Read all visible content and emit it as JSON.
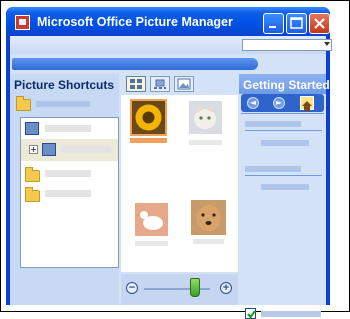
{
  "window": {
    "title": "Microsoft Office Picture Manager",
    "buttons": {
      "minimize": "minimize-icon",
      "maximize": "maximize-icon",
      "close": "close-icon"
    }
  },
  "left_pane": {
    "header": "Picture Shortcuts"
  },
  "right_pane": {
    "header": "Getting Started",
    "nav": [
      "back-icon",
      "forward-icon",
      "home-icon"
    ],
    "show_at_startup_checked": true
  },
  "view_modes": [
    "thumbnail-view-icon",
    "filmstrip-view-icon",
    "single-picture-view-icon"
  ],
  "thumbnails": [
    {
      "icon": "sunflower-icon",
      "selected": true
    },
    {
      "icon": "cat-icon",
      "selected": false
    },
    {
      "icon": "bird-icon",
      "selected": false
    },
    {
      "icon": "dog-icon",
      "selected": false
    }
  ],
  "colors": {
    "titlebar": "#0050e6",
    "close_button": "#c2381c",
    "selection": "#f0a05a",
    "pane_background": "#d4e2f7"
  }
}
